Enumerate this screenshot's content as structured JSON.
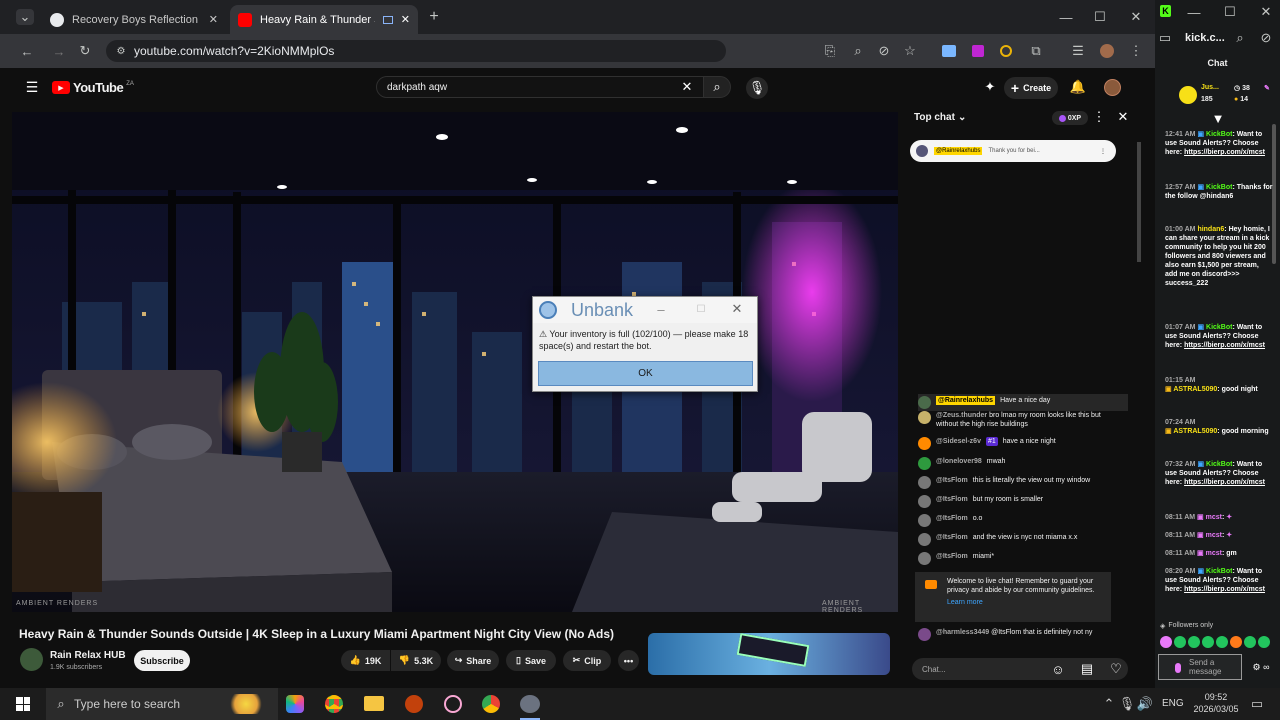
{
  "browser": {
    "tabs": [
      {
        "label": "Recovery Boys Reflection",
        "active": false
      },
      {
        "label": "Heavy Rain & Thunder Sou",
        "active": true
      }
    ],
    "url": "youtube.com/watch?v=2KioNMMplOs"
  },
  "youtube": {
    "logo": "YouTube",
    "region": "ZA",
    "search_value": "darkpath aqw",
    "create_label": "Create",
    "video_title": "Heavy Rain & Thunder Sounds Outside | 4K Sleep in a Luxury Miami Apartment Night City View (No Ads)",
    "watermark_left": "AMBIENT RENDERS",
    "watermark_right": "AMBIENT RENDERS",
    "channel_name": "Rain Relax HUB",
    "subscribers": "1.9K subscribers",
    "subscribe_label": "Subscribe",
    "likes": "19K",
    "dislikes": "5.3K",
    "share_label": "Share",
    "save_label": "Save",
    "clip_label": "Clip"
  },
  "dialog": {
    "title": "Unbank",
    "message": "Your inventory is full (102/100) — please make 18 space(s) and restart the bot.",
    "ok_label": "OK"
  },
  "ytchat": {
    "header": "Top chat",
    "points": "0XP",
    "pinned_name": "@Rainrelaxhubs",
    "pinned_text": "Thank you for bei...",
    "messages": [
      {
        "name": "@Rainrelaxhubs",
        "text": "Have a nice day",
        "highlight": true
      },
      {
        "name": "@Zeus.thunder",
        "text": "bro lmao my room looks like this but without the high rise buildings",
        "highlight": false
      },
      {
        "name": "@Sidesel-z6v",
        "badge": "#1",
        "text": "have a nice night",
        "highlight": false
      },
      {
        "name": "@lonelover98",
        "text": "mwah",
        "highlight": false
      },
      {
        "name": "@ItsFlom",
        "text": "this is literally the view out my window",
        "highlight": false
      },
      {
        "name": "@ItsFlom",
        "text": "but my room is smaller",
        "highlight": false
      },
      {
        "name": "@ItsFlom",
        "text": "o.o",
        "highlight": false
      },
      {
        "name": "@ItsFlom",
        "text": "and the view is nyc not miama x.x",
        "highlight": false
      },
      {
        "name": "@ItsFlom",
        "text": "miami*",
        "highlight": false
      }
    ],
    "welcome": "Welcome to live chat! Remember to guard your privacy and abide by our community guidelines.",
    "learn_more": "Learn more",
    "last_name": "@harmless3449",
    "last_text": "@ItsFlom that is definitely not ny",
    "input_placeholder": "Chat..."
  },
  "kick": {
    "title": "kick.c...",
    "tab": "Chat",
    "user": "Jus...",
    "stat1": "38",
    "stat2": "185",
    "stat3": "14",
    "messages": [
      {
        "time": "12:41 AM",
        "name": "KickBot",
        "text": "Want to use Sound Alerts?? Choose here:",
        "link": "https://bierp.com/x/mcst"
      },
      {
        "time": "12:57 AM",
        "name": "KickBot",
        "text": "Thanks for the follow @hindan6",
        "link": ""
      },
      {
        "time": "01:00 AM",
        "name": "hindan6",
        "text": "Hey homie, I can share your stream in a kick community to help you hit 200 followers and 800 viewers and also earn $1,500 per stream, add me on discord>>> success_222",
        "link": ""
      },
      {
        "time": "01:07 AM",
        "name": "KickBot",
        "text": "Want to use Sound Alerts?? Choose here:",
        "link": "https://bierp.com/x/mcst"
      },
      {
        "time": "01:15 AM",
        "name": "ASTRAL5090",
        "text": "good night",
        "link": ""
      },
      {
        "time": "07:24 AM",
        "name": "ASTRAL5090",
        "text": "good morning",
        "link": ""
      },
      {
        "time": "07:32 AM",
        "name": "KickBot",
        "text": "Want to use Sound Alerts?? Choose here:",
        "link": "https://bierp.com/x/mcst"
      },
      {
        "time": "08:11 AM",
        "name": "mcst",
        "text": "",
        "link": ""
      },
      {
        "time": "08:11 AM",
        "name": "mcst",
        "text": "",
        "link": ""
      },
      {
        "time": "08:11 AM",
        "name": "mcst",
        "text": "gm",
        "link": ""
      },
      {
        "time": "08:20 AM",
        "name": "KickBot",
        "text": "Want to use Sound Alerts?? Choose here:",
        "link": "https://bierp.com/x/mcst"
      }
    ],
    "followers_only": "Followers only",
    "send_placeholder": "Send a message"
  },
  "taskbar": {
    "search_placeholder": "Type here to search",
    "lang": "ENG",
    "time": "09:52",
    "date": "2026/03/05"
  }
}
